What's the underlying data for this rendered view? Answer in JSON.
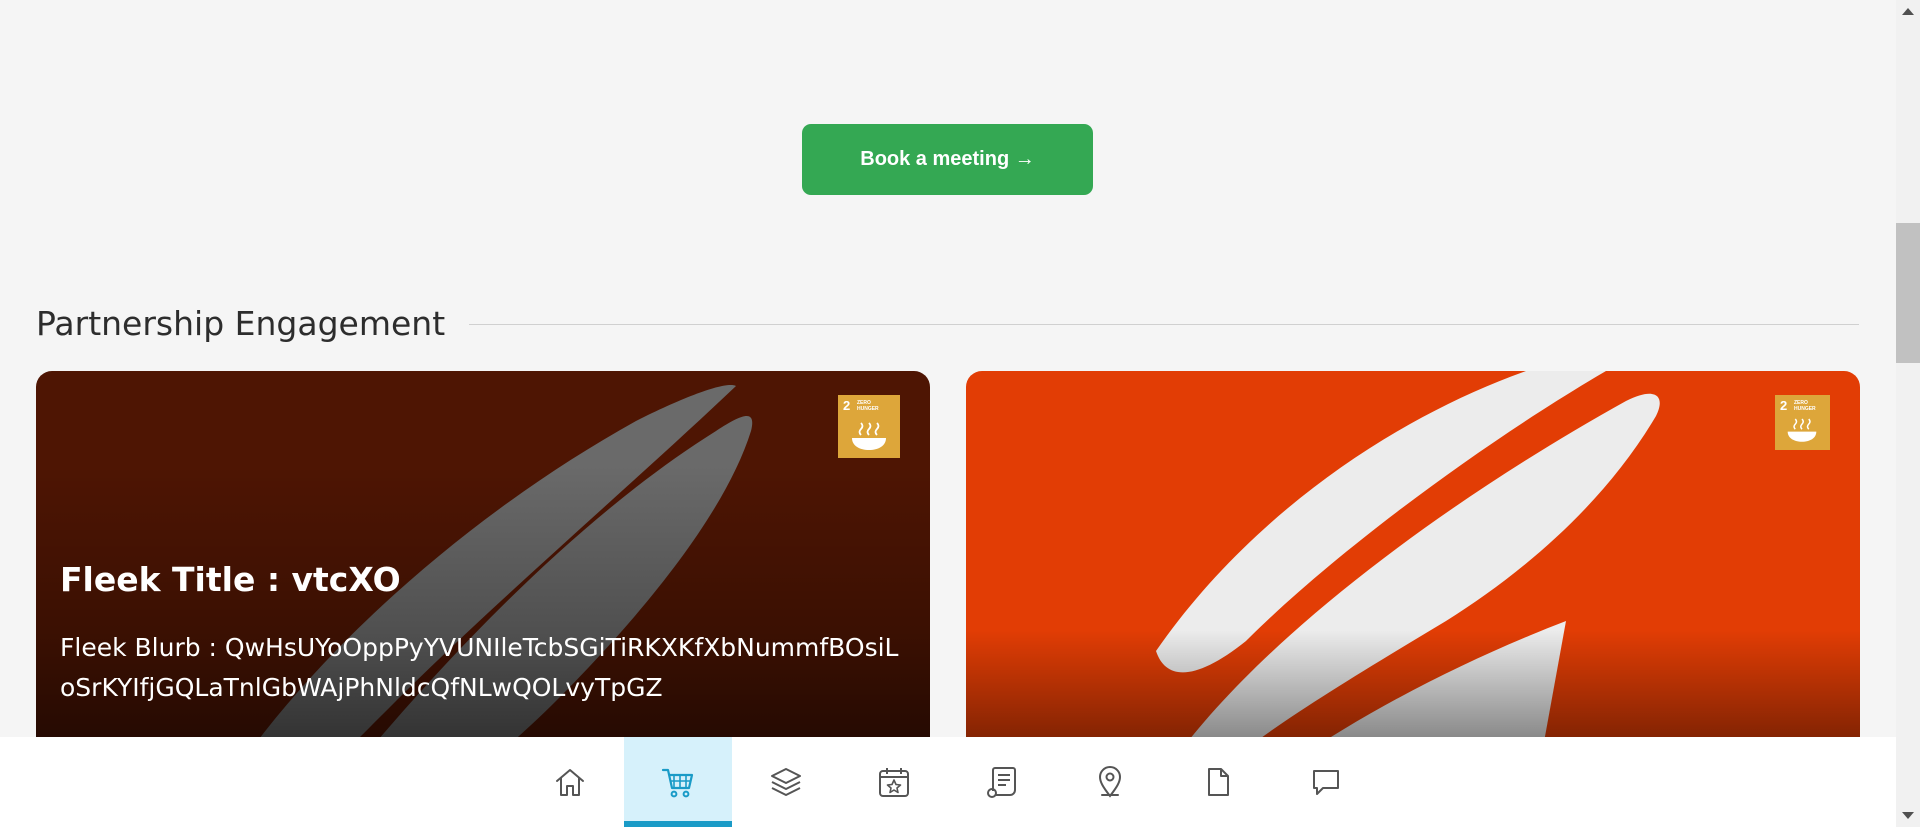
{
  "cta": {
    "book_label": "Book a meeting →"
  },
  "section": {
    "title": "Partnership Engagement"
  },
  "cards": [
    {
      "title": "Fleek Title : vtcXO",
      "blurb": "Fleek Blurb : QwHsUYoOppPyYVUNIleTcbSGiTiRKXKfXbNummfBOsiLoSrKYIfjGQLaTnlGbWAjPhNldcQfNLwQOLvyTpGZ",
      "badge": {
        "number": "2",
        "label": "ZERO HUNGER",
        "color": "#dda63a"
      },
      "bg_color": "#4e1503"
    },
    {
      "badge": {
        "number": "2",
        "label": "ZERO HUNGER",
        "color": "#dda63a"
      },
      "bg_color": "#e23d05"
    }
  ],
  "nav": {
    "items": [
      {
        "icon": "home-icon",
        "active": false
      },
      {
        "icon": "cart-icon",
        "active": true
      },
      {
        "icon": "layers-icon",
        "active": false
      },
      {
        "icon": "calendar-star-icon",
        "active": false
      },
      {
        "icon": "receipt-icon",
        "active": false
      },
      {
        "icon": "map-pin-icon",
        "active": false
      },
      {
        "icon": "document-icon",
        "active": false
      },
      {
        "icon": "chat-icon",
        "active": false
      }
    ],
    "active_color": "#1a9bc7"
  }
}
